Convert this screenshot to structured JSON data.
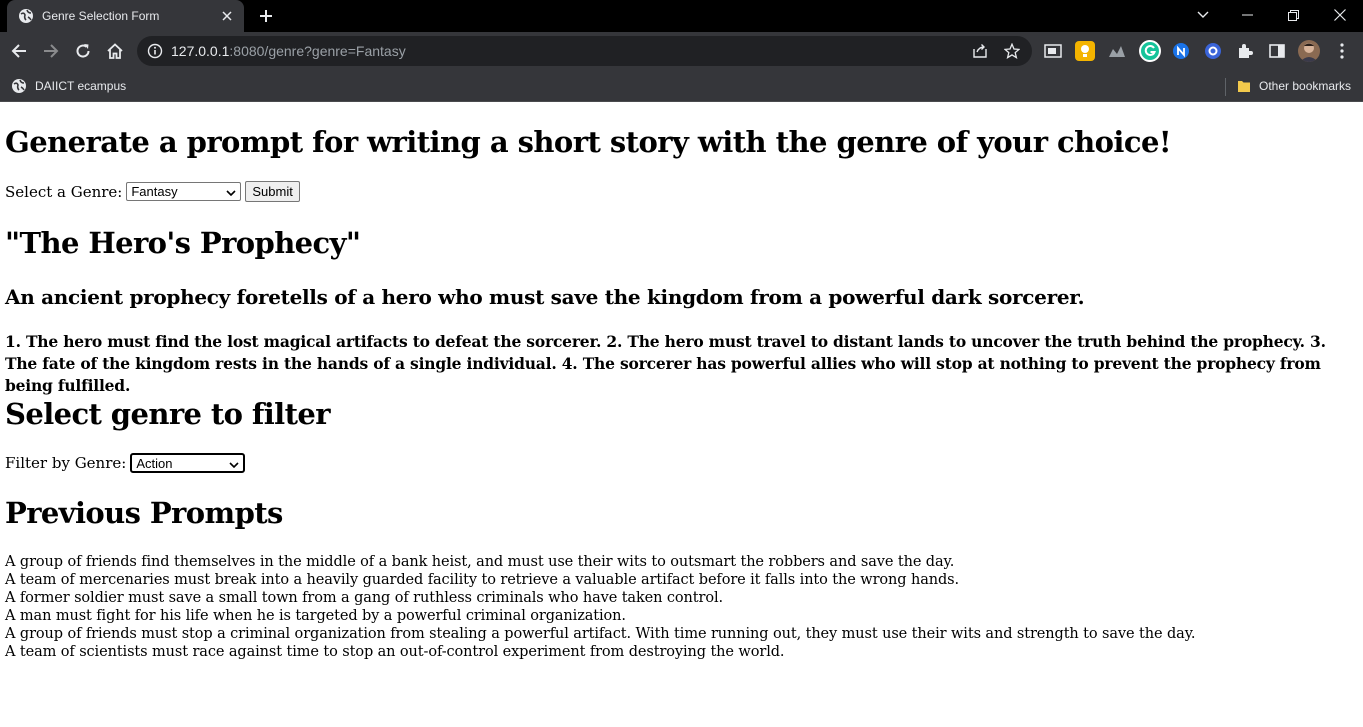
{
  "browser": {
    "tab_title": "Genre Selection Form",
    "url_host": "127.0.0.1",
    "url_rest": ":8080/genre?genre=Fantasy",
    "bookmark_1": "DAIICT ecampus",
    "bookmark_other": "Other bookmarks"
  },
  "page": {
    "heading": "Generate a prompt for writing a short story with the genre of your choice!",
    "genre_label": "Select a Genre: ",
    "genre_selected": "Fantasy",
    "submit_label": "Submit",
    "story_title": "\"The Hero's Prophecy\"",
    "story_premise": "An ancient prophecy foretells of a hero who must save the kingdom from a powerful dark sorcerer.",
    "story_details": "1. The hero must find the lost magical artifacts to defeat the sorcerer. 2. The hero must travel to distant lands to uncover the truth behind the prophecy. 3. The fate of the kingdom rests in the hands of a single individual. 4. The sorcerer has powerful allies who will stop at nothing to prevent the prophecy from being fulfilled.",
    "filter_heading": "Select genre to filter",
    "filter_label": "Filter by Genre: ",
    "filter_selected": "Action",
    "previous_heading": "Previous Prompts",
    "previous_prompts": [
      "A group of friends find themselves in the middle of a bank heist, and must use their wits to outsmart the robbers and save the day.",
      "A team of mercenaries must break into a heavily guarded facility to retrieve a valuable artifact before it falls into the wrong hands.",
      "A former soldier must save a small town from a gang of ruthless criminals who have taken control.",
      "A man must fight for his life when he is targeted by a powerful criminal organization.",
      "A group of friends must stop a criminal organization from stealing a powerful artifact. With time running out, they must use their wits and strength to save the day.",
      "A team of scientists must race against time to stop an out-of-control experiment from destroying the world."
    ]
  },
  "colors": {
    "titlebar": "#000000",
    "chrome": "#35363a",
    "omnibox": "#202124",
    "page_bg": "#ffffff"
  }
}
